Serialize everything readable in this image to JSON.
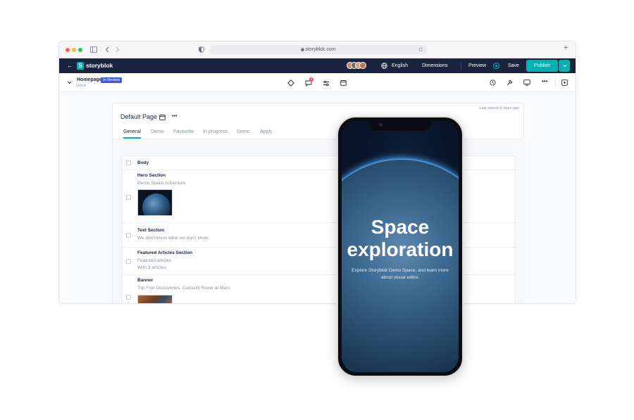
{
  "browser": {
    "url": "storyblok.com",
    "new_tab": "+"
  },
  "topbar": {
    "back": "←",
    "brand": "storyblok",
    "language": "English",
    "dimensions": "Dimensions",
    "preview": "Preview",
    "save": "Save",
    "publish": "Publish"
  },
  "subbar": {
    "page_name": "Homepage",
    "status_badge": "In Review",
    "slug": "home",
    "comments_count": "3"
  },
  "card": {
    "title": "Default Page",
    "more": "•••",
    "last_saved": "Last saved: 8 days ago",
    "tabs": [
      "General",
      "Demo",
      "Favourite",
      "In progress",
      "Demo",
      "Apply"
    ],
    "active_tab": "General"
  },
  "body": {
    "header": "Body",
    "rows": [
      {
        "title": "Hero Section",
        "subtitle": "Demo Space Adventure"
      },
      {
        "title": "Text Section",
        "subtitle": "We don't know what we don't know."
      },
      {
        "title": "Featured Articles Section",
        "subtitle": "Featured articles",
        "subtitle2": "With 3 articles"
      },
      {
        "title": "Banner",
        "subtitle": "Top Five Discoveries, Curiosity Rover at Mars"
      }
    ]
  },
  "phone": {
    "title_line1": "Space",
    "title_line2": "exploration",
    "subtitle": "Explore Storyblok Demo Space, and learn more about visual editor."
  },
  "colors": {
    "navy": "#1b243f",
    "teal": "#00b3b0",
    "badge_blue": "#3b5bdb"
  }
}
